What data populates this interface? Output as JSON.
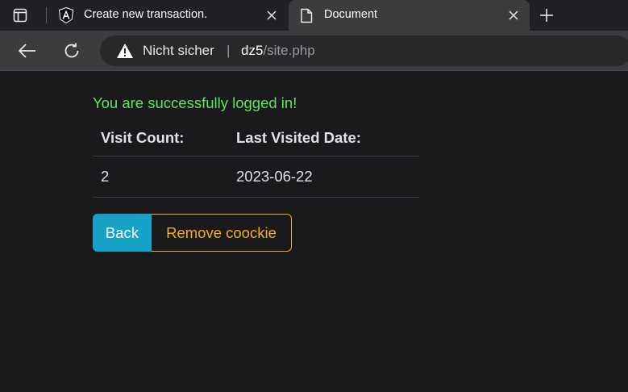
{
  "browser": {
    "tabs": [
      {
        "title": "Create new transaction.",
        "favicon": "angular-icon",
        "active": false
      },
      {
        "title": "Document",
        "favicon": "document-icon",
        "active": true
      }
    ],
    "address_bar": {
      "security_label": "Nicht sicher",
      "separator": "|",
      "host": "dz5",
      "path": "/site.php"
    }
  },
  "page": {
    "success_message": "You are successfully logged in!",
    "table": {
      "headers": [
        "Visit Count:",
        "Last Visited Date:"
      ],
      "rows": [
        [
          "2",
          "2023-06-22"
        ]
      ]
    },
    "buttons": {
      "back_label": "Back",
      "remove_label": "Remove coockie"
    }
  },
  "colors": {
    "success": "#5ce65c",
    "info": "#17a2c8",
    "warning": "#f0ad1e",
    "page_bg": "#1a1a1c"
  }
}
